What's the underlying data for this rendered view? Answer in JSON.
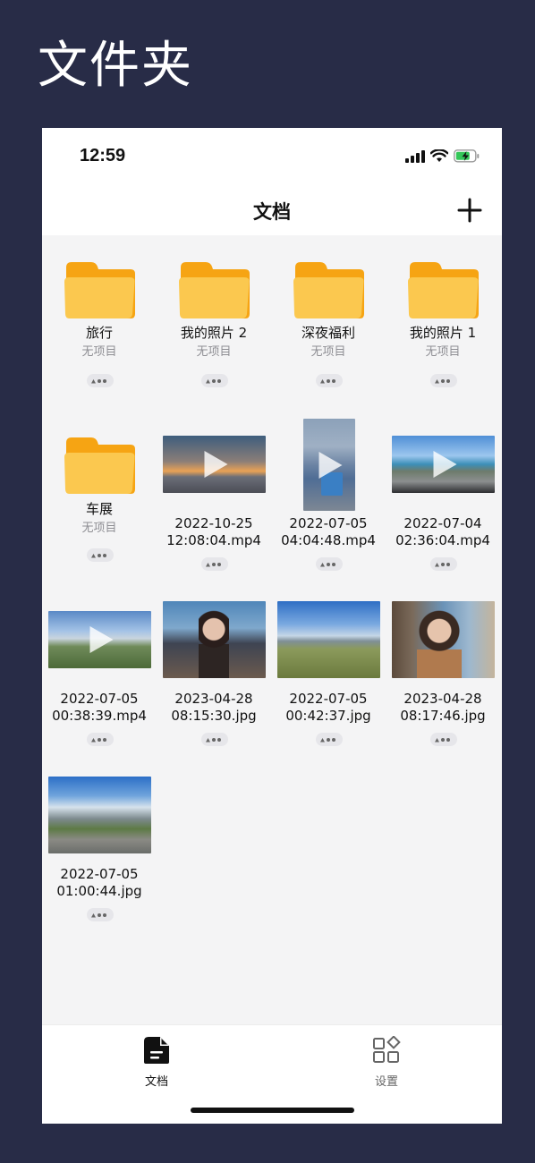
{
  "promo_title": "文件夹",
  "status_bar": {
    "time": "12:59"
  },
  "nav": {
    "title": "文档",
    "add_icon": "plus-icon"
  },
  "folder_color": "#fbc84f",
  "folder_tab_color": "#f6a413",
  "items": [
    {
      "kind": "folder",
      "name": "旅行",
      "sub": "无项目"
    },
    {
      "kind": "folder",
      "name": "我的照片 2",
      "sub": "无项目"
    },
    {
      "kind": "folder",
      "name": "深夜福利",
      "sub": "无项目"
    },
    {
      "kind": "folder",
      "name": "我的照片 1",
      "sub": "无项目"
    },
    {
      "kind": "folder",
      "name": "车展",
      "sub": "无项目"
    },
    {
      "kind": "video",
      "name_line1": "2022-10-25",
      "name_line2": "12:08:04.mp4"
    },
    {
      "kind": "video",
      "name_line1": "2022-07-05",
      "name_line2": "04:04:48.mp4"
    },
    {
      "kind": "video",
      "name_line1": "2022-07-04",
      "name_line2": "02:36:04.mp4"
    },
    {
      "kind": "video",
      "name_line1": "2022-07-05",
      "name_line2": "00:38:39.mp4"
    },
    {
      "kind": "image",
      "name_line1": "2023-04-28",
      "name_line2": "08:15:30.jpg"
    },
    {
      "kind": "image",
      "name_line1": "2022-07-05",
      "name_line2": "00:42:37.jpg"
    },
    {
      "kind": "image",
      "name_line1": "2023-04-28",
      "name_line2": "08:17:46.jpg"
    },
    {
      "kind": "image",
      "name_line1": "2022-07-05",
      "name_line2": "01:00:44.jpg"
    }
  ],
  "tabs": [
    {
      "label": "文档",
      "icon": "document-icon",
      "active": true
    },
    {
      "label": "设置",
      "icon": "settings-grid-icon",
      "active": false
    }
  ]
}
